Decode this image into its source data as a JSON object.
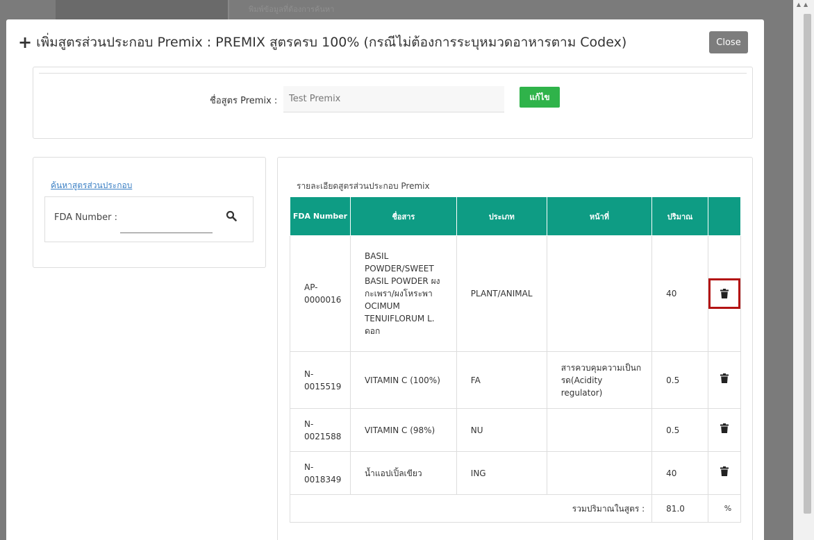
{
  "background": {
    "hint_text": "พิมพ์ข้อมูลที่ต้องการค้นหา"
  },
  "modal": {
    "title": "เพิ่มสูตรส่วนประกอบ Premix : PREMIX สูตรครบ 100% (กรณีไม่ต้องการระบุหมวดอาหารตาม Codex)",
    "close_label": "Close"
  },
  "premix": {
    "name_label": "ชื่อสูตร Premix :",
    "name_placeholder": "Test Premix",
    "edit_label": "แก้ไข"
  },
  "search": {
    "link_label": "ค้นหาสูตรส่วนประกอบ",
    "fda_label": "FDA Number :",
    "fda_value": ""
  },
  "detail": {
    "caption": "รายละเอียดสูตรส่วนประกอบ Premix",
    "headers": [
      "FDA Number",
      "ชื่อสาร",
      "ประเภท",
      "หน้าที่",
      "ปริมาณ",
      ""
    ],
    "rows": [
      {
        "fda": "AP-0000016",
        "name": "BASIL POWDER/SWEET BASIL POWDER ผงกะเพรา/ผงโหระพา OCIMUM TENUIFLORUM L. ดอก",
        "type": "PLANT/ANIMAL",
        "function": "",
        "amount": "40"
      },
      {
        "fda": "N-0015519",
        "name": "VITAMIN C (100%)",
        "type": "FA",
        "function": "สารควบคุมความเป็นกรด(Acidity regulator)",
        "amount": "0.5"
      },
      {
        "fda": "N-0021588",
        "name": "VITAMIN C (98%)",
        "type": "NU",
        "function": "",
        "amount": "0.5"
      },
      {
        "fda": "N-0018349",
        "name": "น้ำแอปเปิ้ลเขียว",
        "type": "ING",
        "function": "",
        "amount": "40"
      }
    ],
    "total_label": "รวมปริมาณในสูตร :",
    "total_value": "81.0",
    "total_unit": "%"
  },
  "icons": {
    "add": "plus-icon",
    "search": "search-icon",
    "delete": "trash-icon"
  },
  "colors": {
    "header_green": "#0e9c84",
    "edit_green": "#2fb34a",
    "highlight_red": "#b31313",
    "link_blue": "#3a7fc4"
  }
}
